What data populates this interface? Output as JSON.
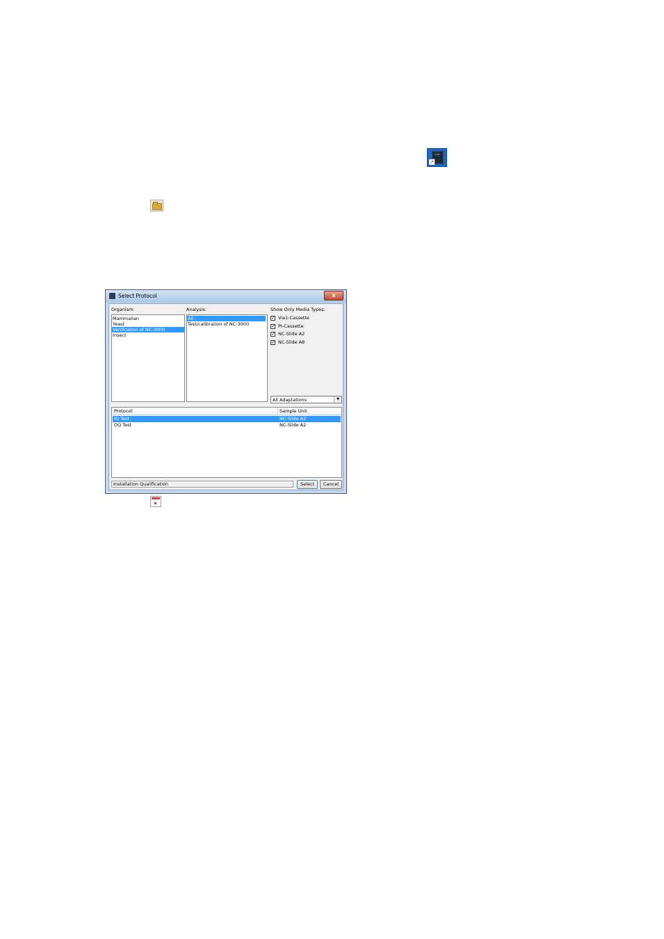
{
  "dialog": {
    "title": "Select Protocol",
    "close_label": "x",
    "organism": {
      "label": "Organism:",
      "items": [
        "Mammalian",
        "Yeast",
        "Verification of NC-3000",
        "Insect"
      ],
      "selected_index": 2
    },
    "analysis": {
      "label": "Analysis:",
      "items": [
        "All",
        "Test/calibration of NC-3000"
      ],
      "selected_index": 0
    },
    "media_types": {
      "label": "Show Only Media Types:",
      "items": [
        {
          "label": "Via1-Cassette",
          "checked": true
        },
        {
          "label": "PI-Cassette",
          "checked": true
        },
        {
          "label": "NC-Slide A2",
          "checked": true
        },
        {
          "label": "NC-Slide A8",
          "checked": true
        }
      ],
      "check_glyph": "✓"
    },
    "adaptations": {
      "value": "All Adaptations",
      "arrow": "▼"
    },
    "protocol_table": {
      "columns": [
        "Protocol",
        "Sample Unit"
      ],
      "rows": [
        {
          "protocol": "IQ Test",
          "sample_unit": "NC-Slide A2",
          "selected": true
        },
        {
          "protocol": "OQ Test",
          "sample_unit": "NC-Slide A2",
          "selected": false
        }
      ]
    },
    "status": "Installation Qualification",
    "select_label": "Select",
    "cancel_label": "Cancel"
  },
  "icons": {
    "app_shortcut": "app-shortcut-icon",
    "folder": "folder-icon",
    "document": "document-icon",
    "shortcut_arrow": "↗"
  },
  "colors": {
    "selection": "#3399ff",
    "title_bar": "#aac6e6",
    "close_button": "#c24c32"
  }
}
